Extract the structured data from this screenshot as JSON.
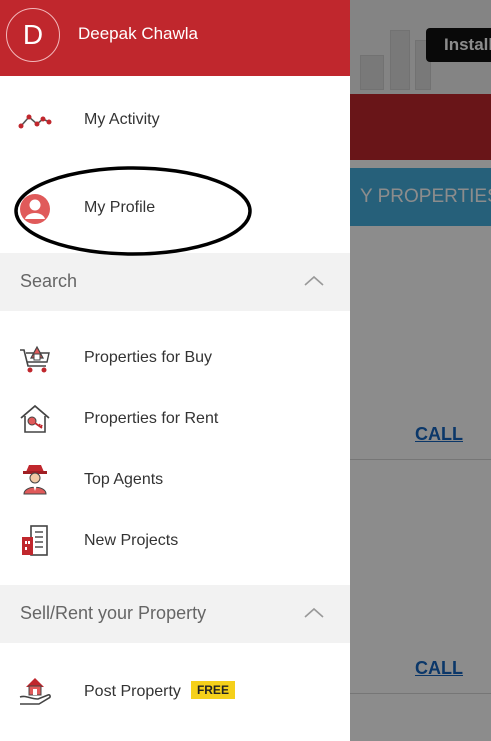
{
  "background": {
    "install_label": "Install",
    "tab_label": "Y PROPERTIES",
    "call_label_1": "CALL",
    "call_label_2": "CALL"
  },
  "header": {
    "avatar_letter": "D",
    "user_name": "Deepak Chawla"
  },
  "menu_top": [
    {
      "label": "My Activity",
      "icon": "activity-graph-icon"
    },
    {
      "label": "My Profile",
      "icon": "profile-avatar-icon"
    }
  ],
  "search_section": {
    "title": "Search",
    "items": [
      {
        "label": "Properties for Buy",
        "icon": "cart-house-icon"
      },
      {
        "label": "Properties for Rent",
        "icon": "house-key-icon"
      },
      {
        "label": "Top Agents",
        "icon": "agent-icon"
      },
      {
        "label": "New Projects",
        "icon": "building-icon"
      }
    ]
  },
  "sell_section": {
    "title": "Sell/Rent your Property",
    "items": [
      {
        "label": "Post Property",
        "icon": "hand-house-icon",
        "badge": "FREE"
      }
    ]
  },
  "colors": {
    "header_red": "#c0272d",
    "accent_blue": "#46b0de",
    "badge_yellow": "#f5d01a"
  }
}
